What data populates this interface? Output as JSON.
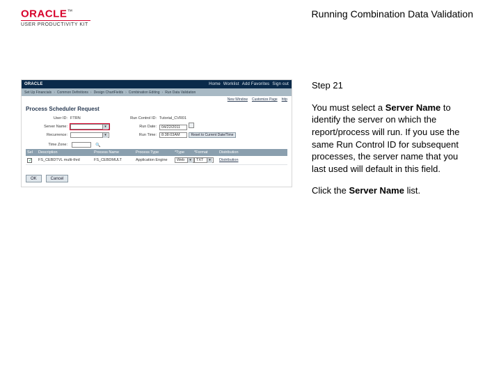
{
  "header": {
    "brand_name": "ORACLE",
    "brand_sub": "USER PRODUCTIVITY KIT",
    "title": "Running Combination Data Validation"
  },
  "panel": {
    "step": "Step 21",
    "para1_pre": "You must select a ",
    "para1_bold": "Server Name",
    "para1_post": " to identify the server on which the report/process will run. If you use the same Run Control ID for subsequent processes, the server name that you last used will default in this field.",
    "para2_pre": "Click the ",
    "para2_bold": "Server Name",
    "para2_post": " list."
  },
  "app": {
    "logo": "ORACLE",
    "toplinks": [
      "Home",
      "Worklist",
      "Add Favorites",
      "Sign out"
    ],
    "breadcrumb": [
      "Set Up Financials",
      "Common Definitions",
      "Design ChartFields",
      "Combination Editing",
      "Run Data Validation"
    ],
    "subbar": {
      "new_window": "New Window",
      "customize": "Customize Page",
      "http": "http"
    },
    "page_title": "Process Scheduler Request",
    "labels": {
      "user_id": "User ID:",
      "run_control": "Run Control ID:",
      "server_name": "Server Name:",
      "run_date": "Run Date:",
      "recurrence": "Recurrence:",
      "run_time": "Run Time:",
      "time_zone": "Time Zone:",
      "reset": "Reset to Current Date/Time"
    },
    "values": {
      "user_id": "FTRN",
      "run_control": "Tutorial_CVR01",
      "server_name": "",
      "run_date": "04/22/2011",
      "recurrence": "",
      "run_time": "8:38:03AM"
    },
    "process_list": {
      "headers": [
        "Sel",
        "Description",
        "Process Name",
        "Process Type",
        "*Type",
        "*Format",
        "Distribution"
      ],
      "row": {
        "selected": true,
        "description": "FS_CEBDTVL multi-thrd",
        "process_name": "FS_CEBDMULT",
        "process_type": "Application Engine",
        "type": "Web",
        "format": "TXT",
        "dist": "Distribution"
      }
    },
    "buttons": {
      "ok": "OK",
      "cancel": "Cancel"
    }
  }
}
